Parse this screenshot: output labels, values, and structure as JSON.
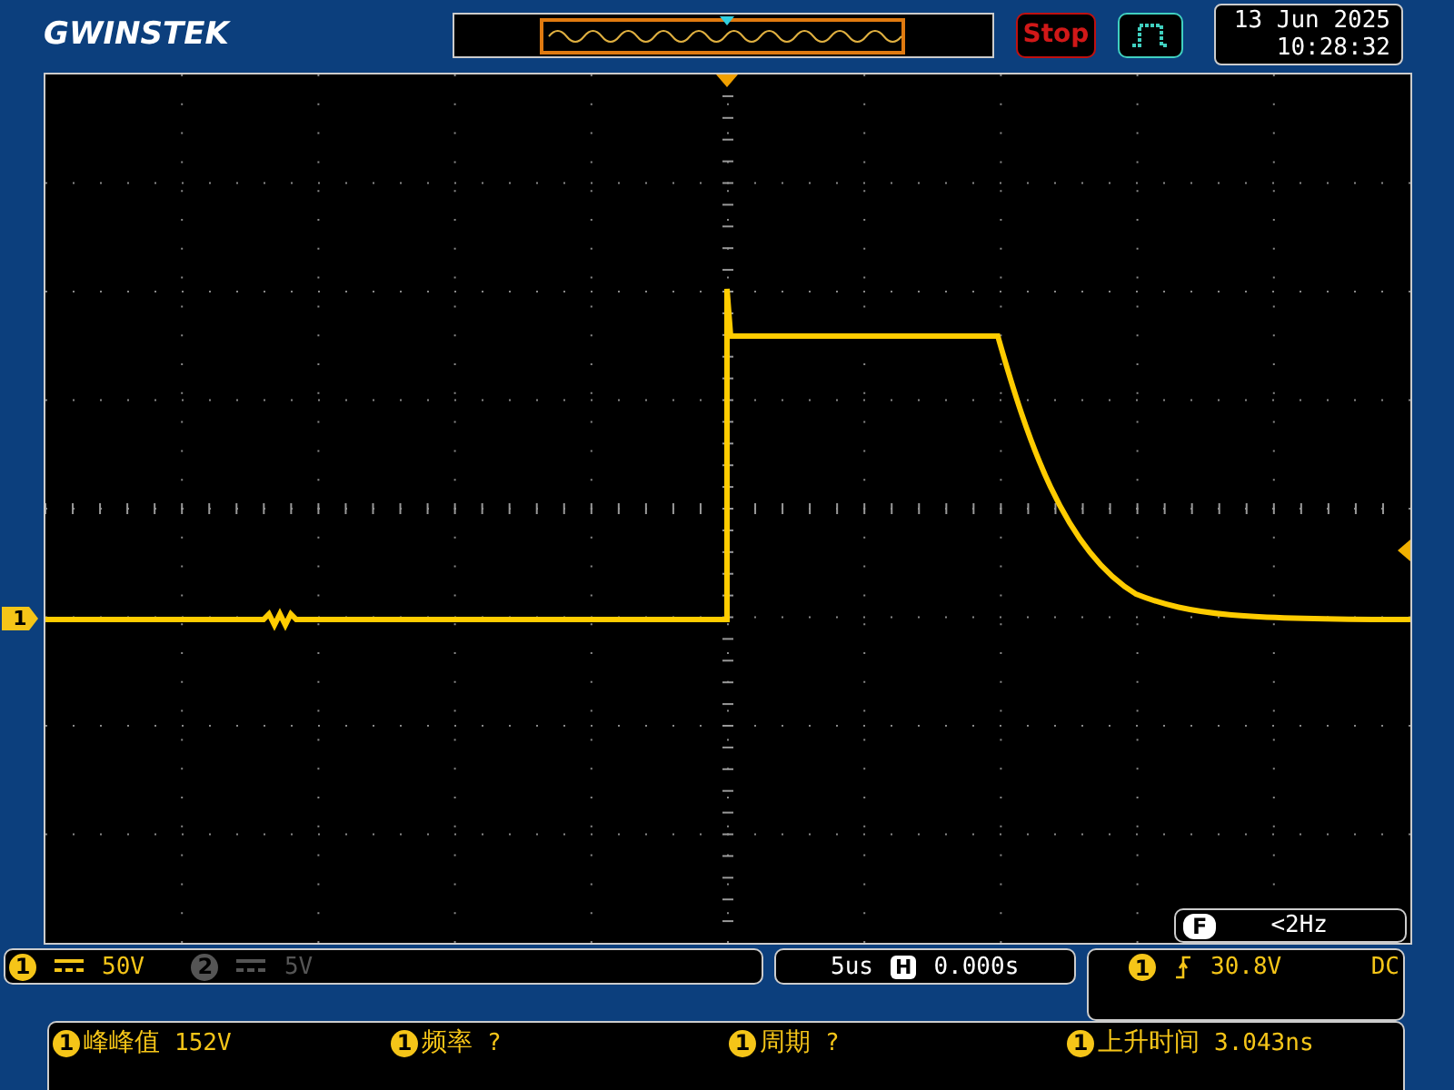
{
  "header": {
    "brand": "GWINSTEK",
    "run_state": "Stop",
    "date": "13 Jun 2025",
    "time": "10:28:32"
  },
  "screen": {
    "channel_marker": "1",
    "frequency_counter": {
      "badge": "F",
      "value": "<2Hz"
    }
  },
  "channels": [
    {
      "number": "1",
      "scale": "50V",
      "on": true
    },
    {
      "number": "2",
      "scale": "5V",
      "on": false
    }
  ],
  "timebase": {
    "scale": "5us",
    "mode_badge": "H",
    "position": "0.000s"
  },
  "trigger": {
    "source": "1",
    "level": "30.8V",
    "coupling": "DC"
  },
  "measurements": [
    {
      "source": "1",
      "name": "峰峰值",
      "value": "152V"
    },
    {
      "source": "1",
      "name": "频率",
      "value": "?"
    },
    {
      "source": "1",
      "name": "周期",
      "value": "?"
    },
    {
      "source": "1",
      "name": "上升时间",
      "value": "3.043ns"
    }
  ]
}
